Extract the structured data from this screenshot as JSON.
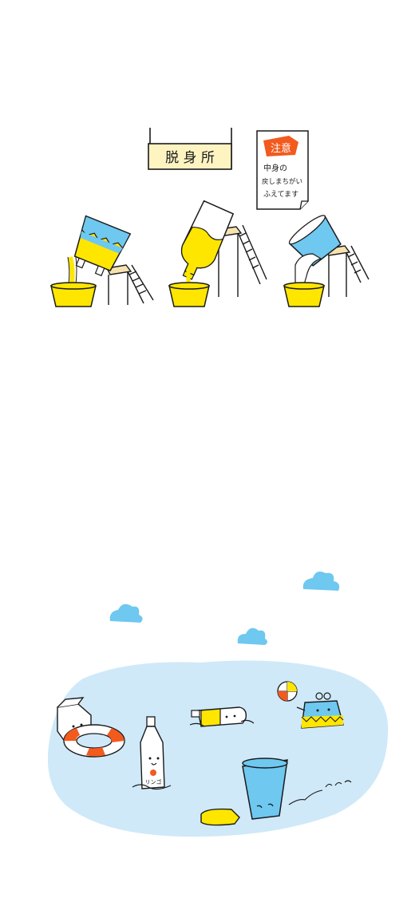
{
  "top_scene": {
    "sign_label": "脱 身 所",
    "notice": {
      "badge": "注意",
      "lines": [
        "中身の",
        "戻しまちがい",
        "ふえてます"
      ]
    }
  },
  "bottom_scene": {
    "bottle_label": "リンゴ"
  },
  "colors": {
    "yellow": "#ffe600",
    "blue": "#6ec8f0",
    "pool": "#cfe9f9",
    "orange": "#f25a1e",
    "ink": "#1a1a1a"
  }
}
